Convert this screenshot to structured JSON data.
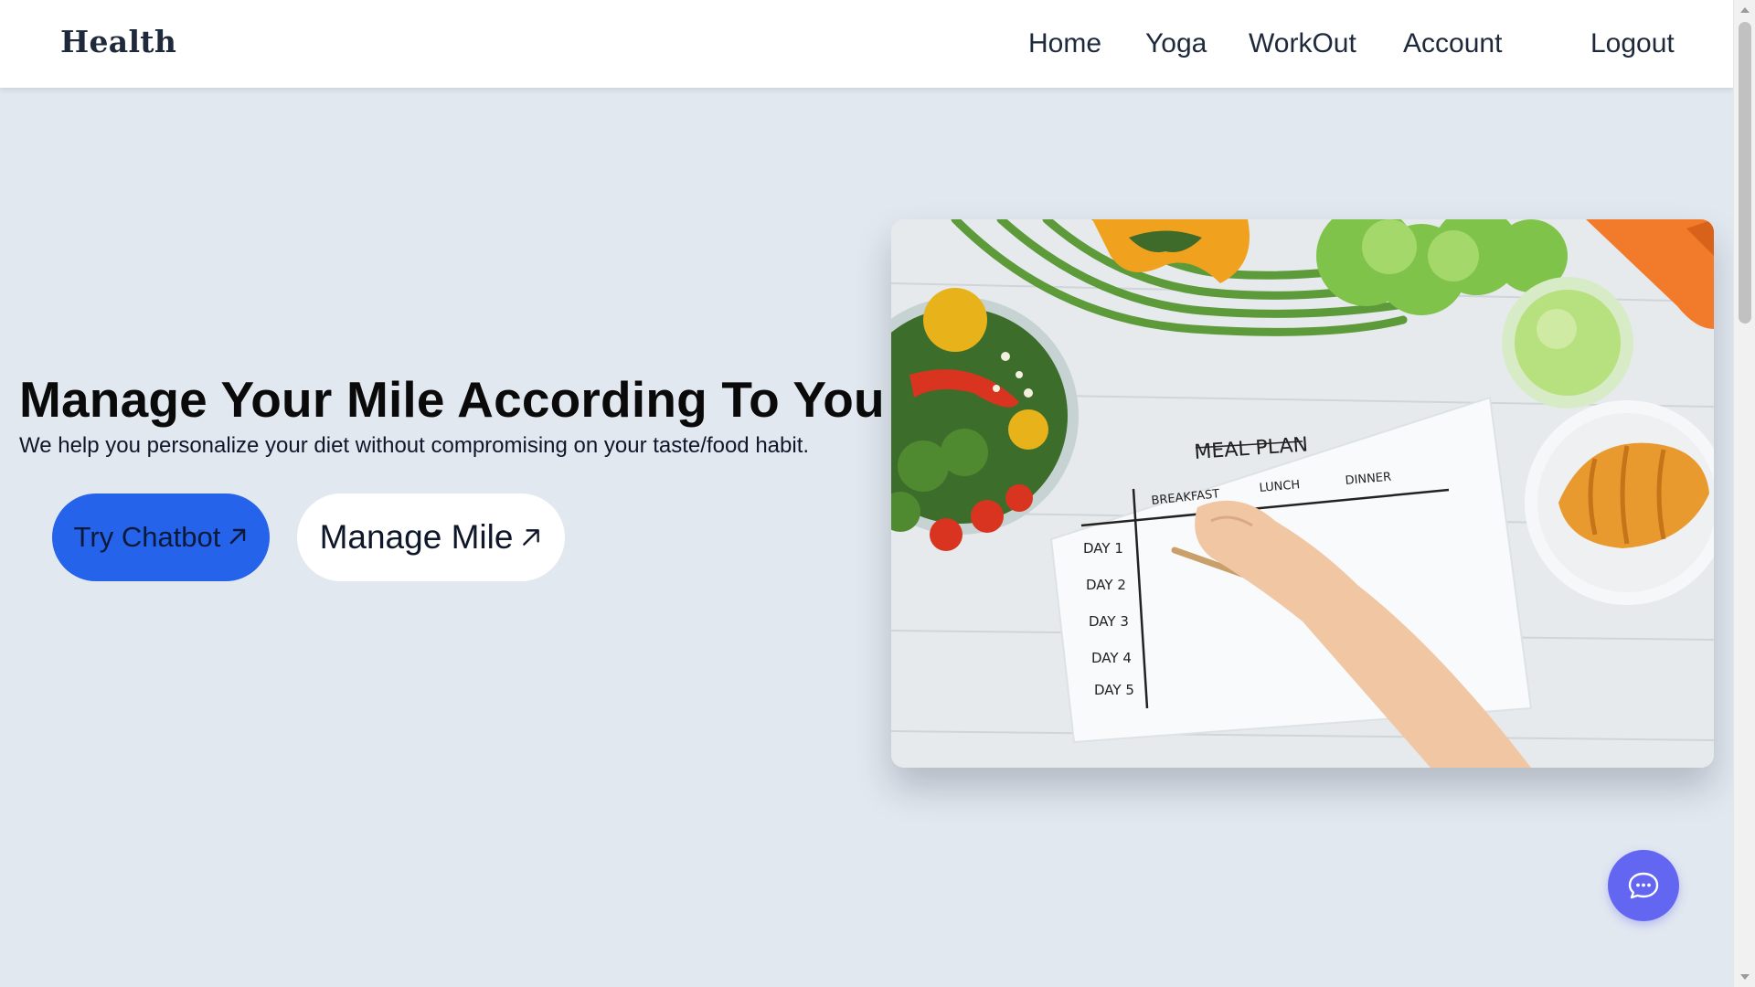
{
  "navbar": {
    "brand": "Health",
    "links": [
      "Home",
      "Yoga",
      "WorkOut",
      "Account"
    ],
    "logout_label": "Logout"
  },
  "hero": {
    "title": "Manage Your Mile According To You",
    "subtitle": "We help you personalize your diet without compromising on your taste/food habit.",
    "primary_button": {
      "label": "Try Chatbot",
      "icon": "arrow-up-right-icon",
      "color": "#2563eb"
    },
    "secondary_button": {
      "label": "Manage Mile",
      "icon": "arrow-up-right-icon",
      "color": "#ffffff"
    }
  },
  "image": {
    "meal_plan_title": "MEAL PLAN",
    "columns": [
      "BREAKFAST",
      "LUNCH",
      "DINNER"
    ],
    "rows": [
      "DAY 1",
      "DAY 2",
      "DAY 3",
      "DAY 4",
      "DAY 5"
    ]
  },
  "chat_fab": {
    "icon": "chat-bubble-icon",
    "color": "#6366f1"
  },
  "theme": {
    "background": "#e2e8f0",
    "text": "#0f172a"
  }
}
